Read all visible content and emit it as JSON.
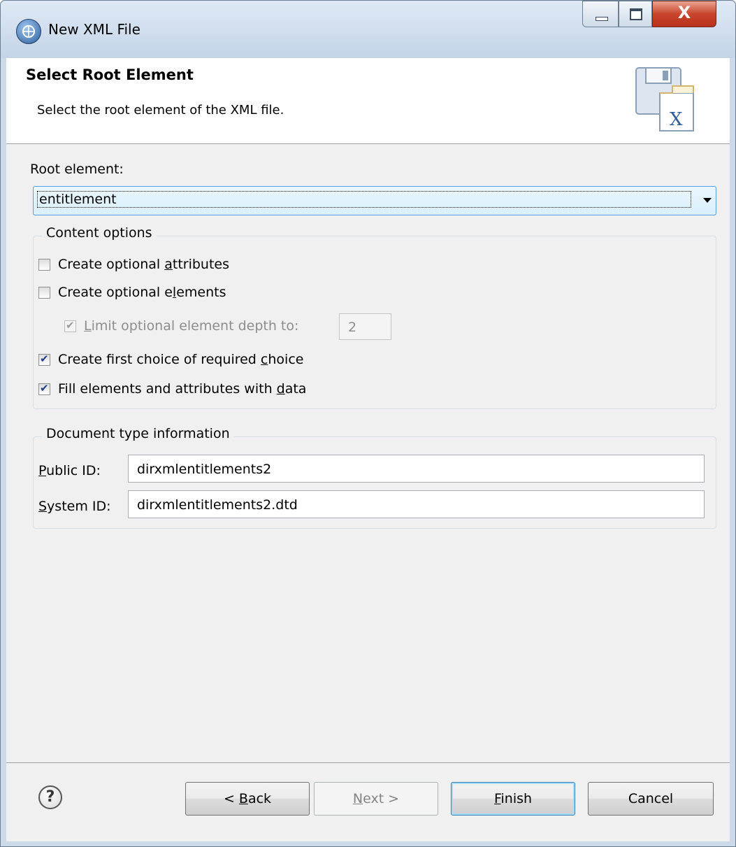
{
  "window": {
    "title": "New XML File",
    "close_glyph": "X"
  },
  "header": {
    "title": "Select Root Element",
    "description": "Select the root element of the XML file."
  },
  "root_element": {
    "label": "Root element:",
    "selected": "entitlement"
  },
  "content_options": {
    "legend": "Content options",
    "options": [
      {
        "label_pre": "Create optional ",
        "mnemonic": "a",
        "label_post": "ttributes",
        "checked": false,
        "enabled": true
      },
      {
        "label_pre": "Create optional e",
        "mnemonic": "l",
        "label_post": "ements",
        "checked": false,
        "enabled": true
      },
      {
        "label_pre": "",
        "mnemonic": "L",
        "label_post": "imit optional element depth to:",
        "checked": true,
        "enabled": false
      },
      {
        "label_pre": "Create first choice of required ",
        "mnemonic": "c",
        "label_post": "hoice",
        "checked": true,
        "enabled": true
      },
      {
        "label_pre": "Fill elements and attributes with ",
        "mnemonic": "d",
        "label_post": "ata",
        "checked": true,
        "enabled": true
      }
    ],
    "depth_value": "2"
  },
  "doctype": {
    "legend": "Document type information",
    "public_mnemonic": "P",
    "public_label_rest": "ublic ID:",
    "public_value": "dirxmlentitlements2",
    "system_mnemonic": "S",
    "system_label_rest": "ystem ID:",
    "system_value": "dirxmlentitlements2.dtd"
  },
  "footer": {
    "help_glyph": "?",
    "back_pre": "< ",
    "back_mnemonic": "B",
    "back_post": "ack",
    "next_mnemonic": "N",
    "next_post": "ext >",
    "finish_mnemonic": "F",
    "finish_post": "inish",
    "cancel": "Cancel"
  },
  "icons": [
    "app-icon",
    "minimize-icon",
    "maximize-icon",
    "close-icon",
    "xml-wizard-icon",
    "help-icon",
    "dropdown-arrow-icon"
  ]
}
